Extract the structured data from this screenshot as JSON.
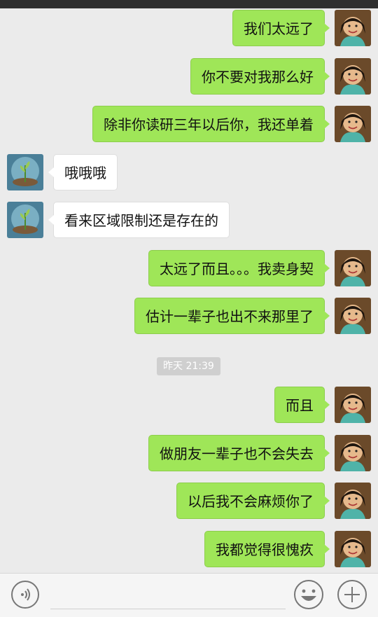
{
  "messages": [
    {
      "side": "right",
      "text": "我们太远了"
    },
    {
      "side": "right",
      "text": "你不要对我那么好"
    },
    {
      "side": "right",
      "text": "除非你读研三年以后你，我还单着"
    },
    {
      "side": "left",
      "text": "哦哦哦"
    },
    {
      "side": "left",
      "text": "看来区域限制还是存在的"
    },
    {
      "side": "right",
      "text": "太远了而且。。。我卖身契"
    },
    {
      "side": "right",
      "text": "估计一辈子也出不来那里了"
    },
    {
      "side": "right",
      "text": "而且"
    },
    {
      "side": "right",
      "text": "做朋友一辈子也不会失去"
    },
    {
      "side": "right",
      "text": "以后我不会麻烦你了"
    },
    {
      "side": "right",
      "text": "我都觉得很愧疚"
    }
  ],
  "timestamp": "昨天 21:39",
  "colors": {
    "sent_bubble": "#9fe658",
    "received_bubble": "#ffffff",
    "chat_background": "#ebebeb"
  },
  "icons": {
    "voice": "voice-input-icon",
    "emoji": "emoji-icon",
    "plus": "plus-icon"
  }
}
